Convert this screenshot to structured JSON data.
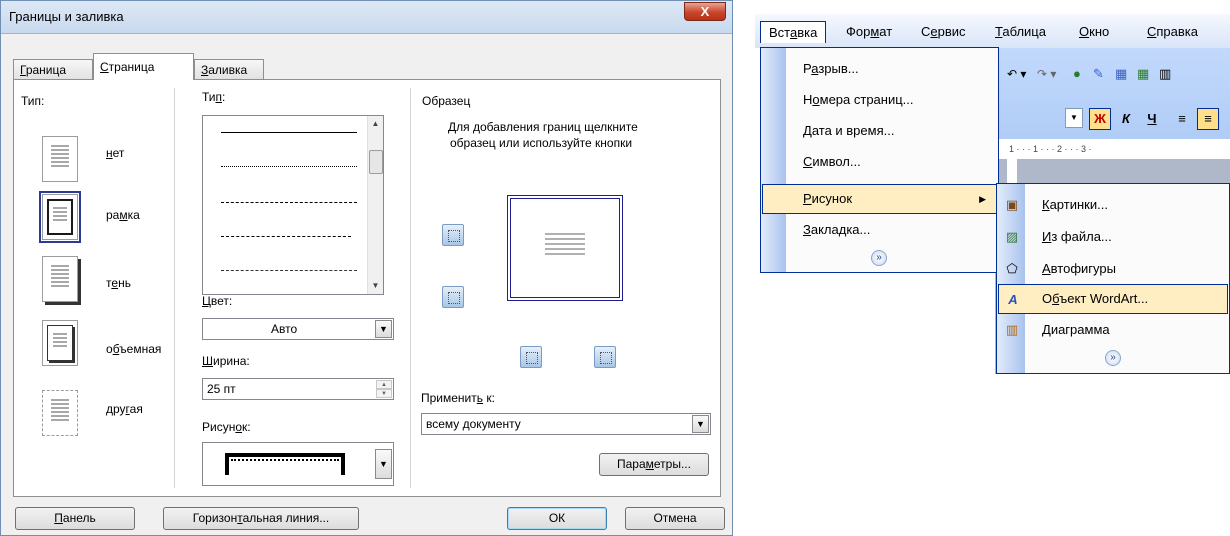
{
  "dialog": {
    "title": "Границы и заливка",
    "close_glyph": "X",
    "tabs": [
      {
        "pre": "",
        "ul": "Г",
        "post": "раница"
      },
      {
        "pre": "",
        "ul": "С",
        "post": "траница"
      },
      {
        "pre": "",
        "ul": "З",
        "post": "аливка"
      }
    ],
    "type_label": "Тип:",
    "types": [
      {
        "pre": "",
        "ul": "н",
        "post": "ет"
      },
      {
        "pre": "ра",
        "ul": "м",
        "post": "ка"
      },
      {
        "pre": "т",
        "ul": "е",
        "post": "нь"
      },
      {
        "pre": "о",
        "ul": "б",
        "post": "ъемная"
      },
      {
        "pre": "дру",
        "ul": "г",
        "post": "ая"
      }
    ],
    "line_type_label": {
      "pre": "Ти",
      "ul": "п",
      "post": ":"
    },
    "color_label": {
      "pre": "",
      "ul": "Ц",
      "post": "вет:"
    },
    "color_value": "Авто",
    "width_label": {
      "pre": "",
      "ul": "Ш",
      "post": "ирина:"
    },
    "width_value": "25 пт",
    "art_label": {
      "pre": "Рисун",
      "ul": "о",
      "post": "к:"
    },
    "preview_label": "Образец",
    "preview_hint_1": "Для добавления границ щелкните",
    "preview_hint_2": "образец или используйте кнопки",
    "apply_label": {
      "pre": "Применит",
      "ul": "ь",
      "post": " к:"
    },
    "apply_value": "всему документу",
    "options_button": {
      "pre": "Пара",
      "ul": "м",
      "post": "етры..."
    },
    "panel_button": {
      "pre": "",
      "ul": "П",
      "post": "анель"
    },
    "hline_button": {
      "pre": "Горизон",
      "ul": "т",
      "post": "альная линия..."
    },
    "ok_button": "ОК",
    "cancel_button": "Отмена"
  },
  "menu": {
    "bar": [
      {
        "pre": "Вст",
        "ul": "а",
        "post": "вка"
      },
      {
        "pre": "Фор",
        "ul": "м",
        "post": "ат"
      },
      {
        "pre": "С",
        "ul": "е",
        "post": "рвис"
      },
      {
        "pre": "",
        "ul": "Т",
        "post": "аблица"
      },
      {
        "pre": "",
        "ul": "О",
        "post": "кно"
      },
      {
        "pre": "",
        "ul": "С",
        "post": "правка"
      }
    ],
    "items": [
      {
        "pre": "Р",
        "ul": "а",
        "post": "зрыв..."
      },
      {
        "pre": "Н",
        "ul": "о",
        "post": "мера страниц..."
      },
      {
        "pre": "",
        "ul": "Д",
        "post": "ата и время..."
      },
      {
        "pre": "",
        "ul": "С",
        "post": "имвол..."
      },
      {
        "pre": "",
        "ul": "Р",
        "post": "исунок"
      },
      {
        "pre": "",
        "ul": "З",
        "post": "акладка..."
      }
    ],
    "expand_glyph": "»",
    "submenu": [
      {
        "pre": "",
        "ul": "К",
        "post": "артинки..."
      },
      {
        "pre": "",
        "ul": "И",
        "post": "з файла..."
      },
      {
        "pre": "",
        "ul": "А",
        "post": "втофигуры"
      },
      {
        "pre": "О",
        "ul": "б",
        "post": "ъект WordArt..."
      },
      {
        "pre": "",
        "ul": "Д",
        "post": "иаграмма"
      }
    ],
    "toolbar": {
      "bold": "Ж",
      "italic": "К",
      "underline": "Ч",
      "ruler": "1 · · · 1 · · · 2 · · · 3 ·"
    }
  }
}
